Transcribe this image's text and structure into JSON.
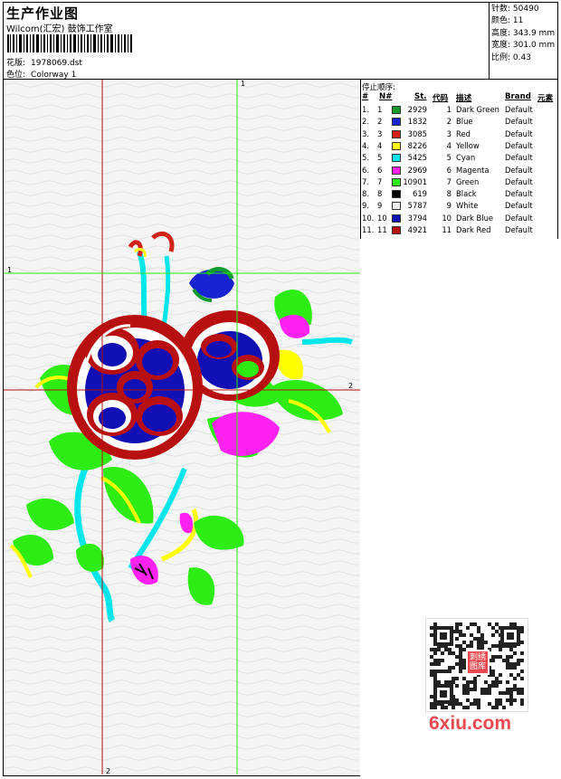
{
  "header": {
    "title": "生产作业图",
    "company": "Wilcom(汇宏) 鼓饰工作室",
    "design_label": "花版:",
    "design_value": "1978069.dst",
    "colorway_label": "色位:",
    "colorway_value": "Colorway 1"
  },
  "stats": [
    {
      "label": "针数:",
      "value": "50490"
    },
    {
      "label": "颜色:",
      "value": "11"
    },
    {
      "label": "高度:",
      "value": "343.9 mm"
    },
    {
      "label": "宽度:",
      "value": "301.0 mm"
    },
    {
      "label": "比例:",
      "value": "0.43"
    }
  ],
  "stop_sequence": {
    "title": "停止顺序:",
    "headers": {
      "hash": "#",
      "n": "N#",
      "st": "St.",
      "code": "代码",
      "desc": "描述",
      "brand": "Brand",
      "element": "元素"
    },
    "rows": [
      {
        "no": "1.",
        "n": "1",
        "color": "#129b2a",
        "st": "2929",
        "code": "1",
        "desc": "Dark Green",
        "brand": "Default"
      },
      {
        "no": "2.",
        "n": "2",
        "color": "#1823d2",
        "st": "1832",
        "code": "2",
        "desc": "Blue",
        "brand": "Default"
      },
      {
        "no": "3.",
        "n": "3",
        "color": "#d2231a",
        "st": "3085",
        "code": "3",
        "desc": "Red",
        "brand": "Default"
      },
      {
        "no": "4.",
        "n": "4",
        "color": "#ffff00",
        "st": "8226",
        "code": "4",
        "desc": "Yellow",
        "brand": "Default"
      },
      {
        "no": "5.",
        "n": "5",
        "color": "#00e6ea",
        "st": "5425",
        "code": "5",
        "desc": "Cyan",
        "brand": "Default"
      },
      {
        "no": "6.",
        "n": "6",
        "color": "#ff22f0",
        "st": "2969",
        "code": "6",
        "desc": "Magenta",
        "brand": "Default"
      },
      {
        "no": "7.",
        "n": "7",
        "color": "#2ded14",
        "st": "10901",
        "code": "7",
        "desc": "Green",
        "brand": "Default"
      },
      {
        "no": "8.",
        "n": "8",
        "color": "#000000",
        "st": "619",
        "code": "8",
        "desc": "Black",
        "brand": "Default"
      },
      {
        "no": "9.",
        "n": "9",
        "color": "#f2f2f2",
        "st": "5787",
        "code": "9",
        "desc": "White",
        "brand": "Default"
      },
      {
        "no": "10.",
        "n": "10",
        "color": "#1010b4",
        "st": "3794",
        "code": "10",
        "desc": "Dark Blue",
        "brand": "Default"
      },
      {
        "no": "11.",
        "n": "11",
        "color": "#b81010",
        "st": "4921",
        "code": "11",
        "desc": "Dark Red",
        "brand": "Default"
      }
    ]
  },
  "guides": {
    "v1": "1",
    "h1": "1",
    "h2": "2",
    "v2": "2"
  },
  "watermark": "6xiu.com",
  "qr_stamp": "刺绣图库"
}
